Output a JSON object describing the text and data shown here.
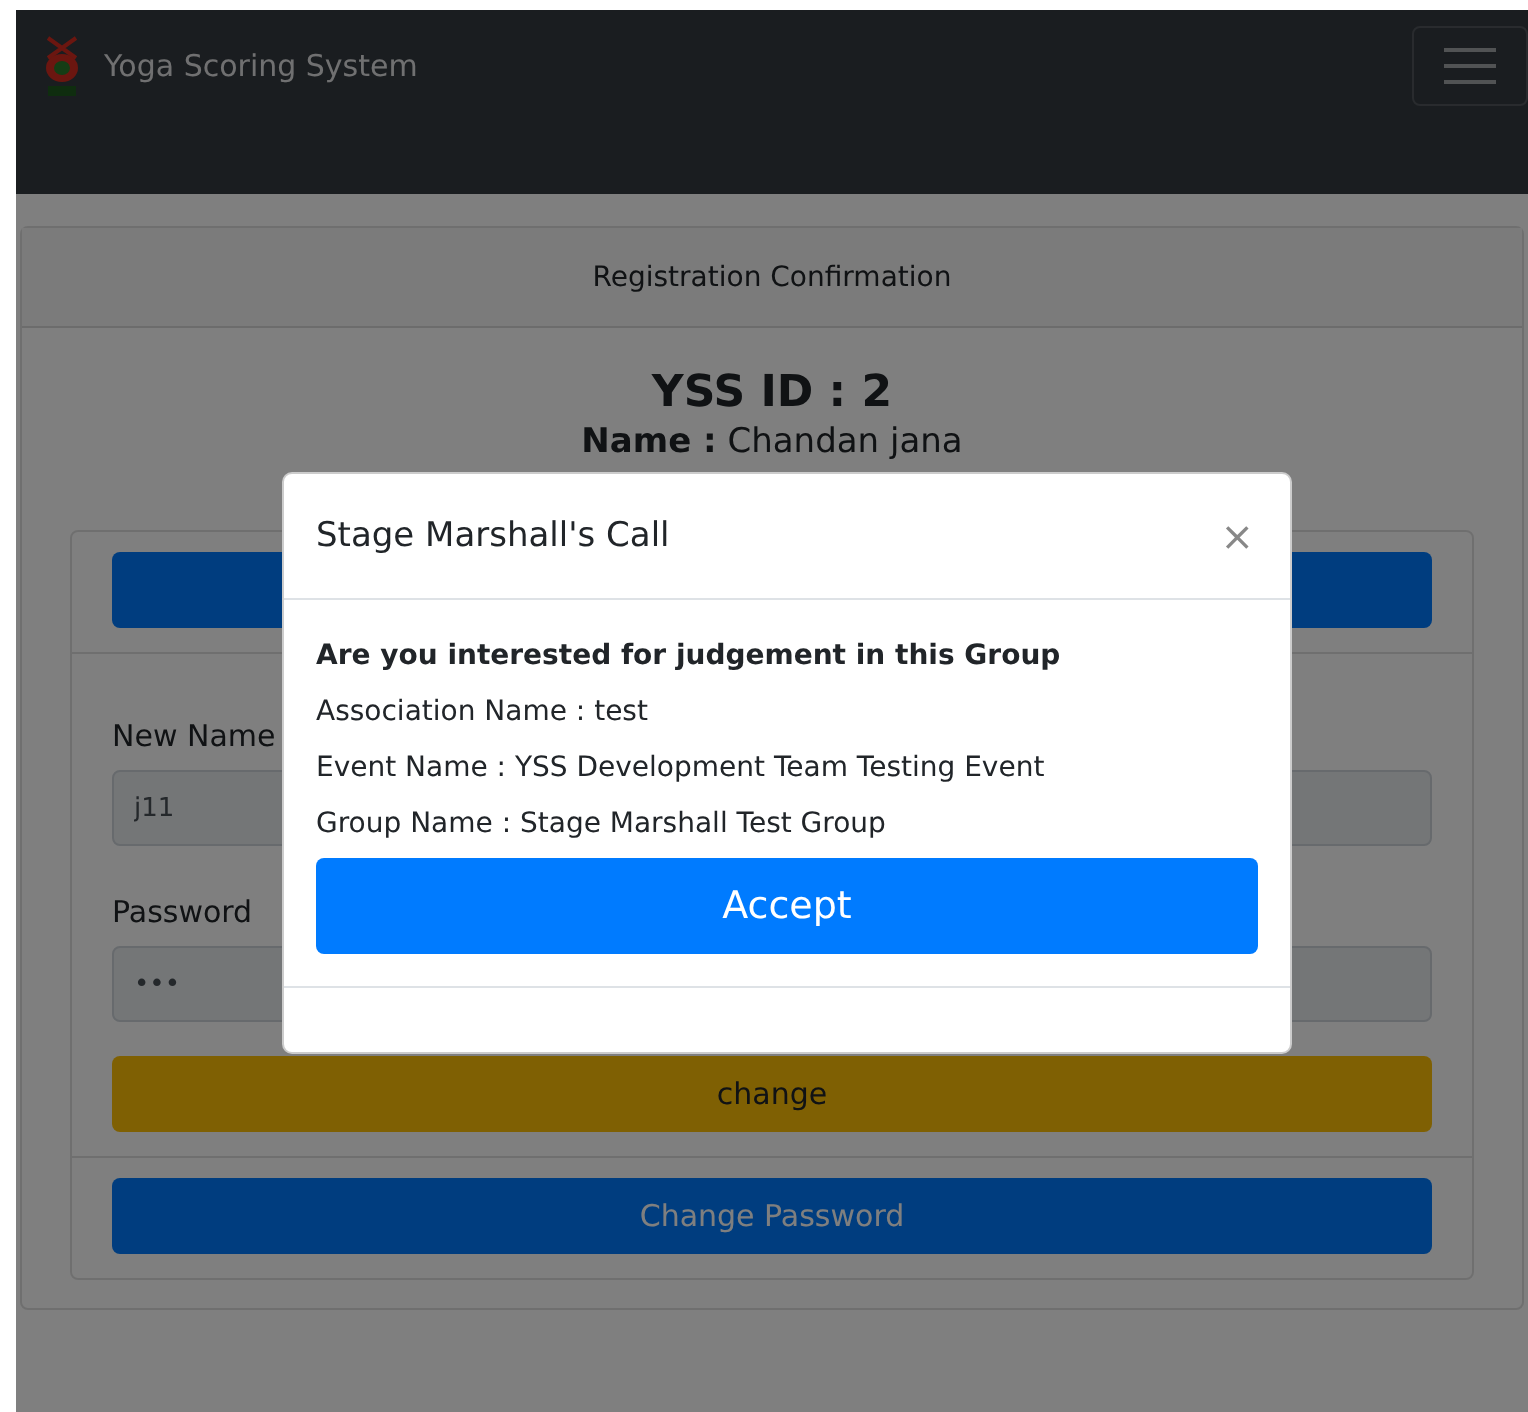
{
  "navbar": {
    "brand": "Yoga Scoring System"
  },
  "card": {
    "header": "Registration Confirmation",
    "yss_id": "YSS ID : 2",
    "name_label": "Name :",
    "name": "Chandan jana",
    "fields": [
      {
        "label": "New Name",
        "value": "j11"
      },
      {
        "label": "Password",
        "value": "•••"
      }
    ],
    "change_button": "change",
    "change_password_button": "Change Password"
  },
  "modal": {
    "title": "Stage Marshall's Call",
    "close": "×",
    "question": "Are you interested for judgement in this Group",
    "lines": [
      "Association Name : test",
      "Event Name : YSS Development Team Testing Event",
      "Group Name : Stage Marshall Test Group"
    ],
    "accept": "Accept"
  }
}
